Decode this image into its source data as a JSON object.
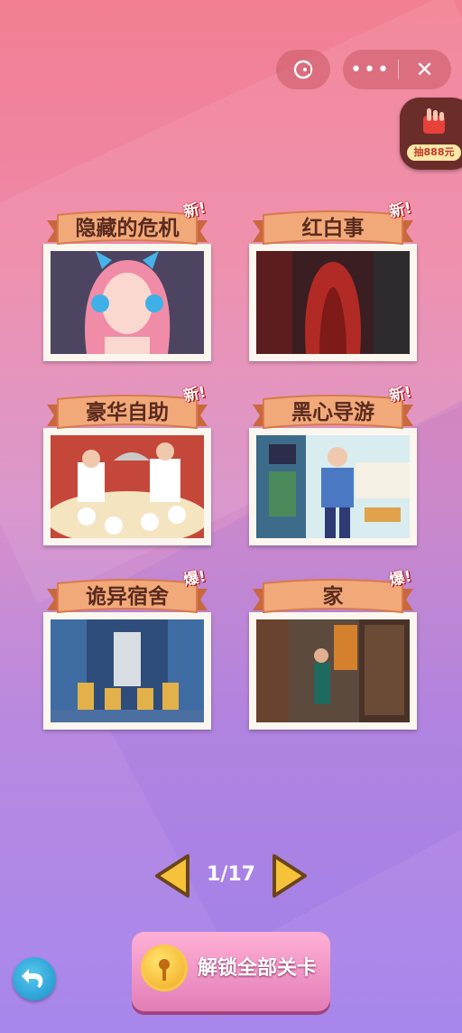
{
  "window": {
    "more_icon": "more-dots-icon",
    "close_icon": "close-x-icon",
    "game_icon": "game-pie-icon"
  },
  "lottery": {
    "label": "抽888元",
    "icon": "hand-icon"
  },
  "levels": [
    {
      "title": "隐藏的危机",
      "badge": "新!"
    },
    {
      "title": "红白事",
      "badge": "新!"
    },
    {
      "title": "豪华自助",
      "badge": "新!"
    },
    {
      "title": "黑心导游",
      "badge": "新!"
    },
    {
      "title": "诡异宿舍",
      "badge": "爆!"
    },
    {
      "title": "家",
      "badge": "爆!"
    }
  ],
  "pager": {
    "label": "1/17"
  },
  "unlock_button": {
    "label": "解锁全部关卡"
  },
  "back_button": {
    "icon": "back-arrow-icon"
  },
  "colors": {
    "ribbon": "#f0a070",
    "badge_red": "#e0282b",
    "frame": "#fbf7ef",
    "arrow": "#f5c23a"
  }
}
